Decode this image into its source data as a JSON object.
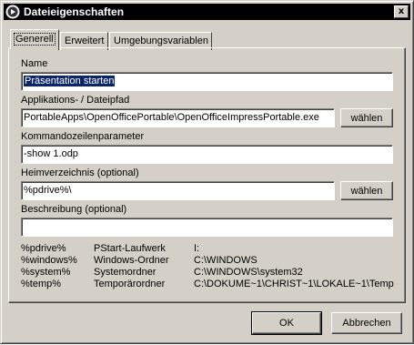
{
  "window": {
    "title": "Dateieigenschaften",
    "close_glyph": "x",
    "icon": "play-circle-icon"
  },
  "tabs": [
    {
      "label": "Generell",
      "active": true
    },
    {
      "label": "Erweitert",
      "active": false
    },
    {
      "label": "Umgebungsvariablen",
      "active": false
    }
  ],
  "form": {
    "name_label": "Name",
    "name_value": "Präsentation starten",
    "path_label": "Applikations- / Dateipfad",
    "path_value": "PortableApps\\OpenOfficePortable\\OpenOfficeImpressPortable.exe",
    "path_browse": "wählen",
    "params_label": "Kommandozeilenparameter",
    "params_value": "-show 1.odp",
    "home_label": "Heimverzeichnis (optional)",
    "home_value": "%pdrive%\\",
    "home_browse": "wählen",
    "desc_label": "Beschreibung (optional)",
    "desc_value": ""
  },
  "variables": [
    {
      "name": "%pdrive%",
      "description": "PStart-Laufwerk",
      "value": "I:"
    },
    {
      "name": "%windows%",
      "description": "Windows-Ordner",
      "value": "C:\\WINDOWS"
    },
    {
      "name": "%system%",
      "description": "Systemordner",
      "value": "C:\\WINDOWS\\system32"
    },
    {
      "name": "%temp%",
      "description": "Temporärordner",
      "value": "C:\\DOKUME~1\\CHRIST~1\\LOKALE~1\\Temp"
    }
  ],
  "buttons": {
    "ok": "OK",
    "cancel": "Abbrechen"
  }
}
